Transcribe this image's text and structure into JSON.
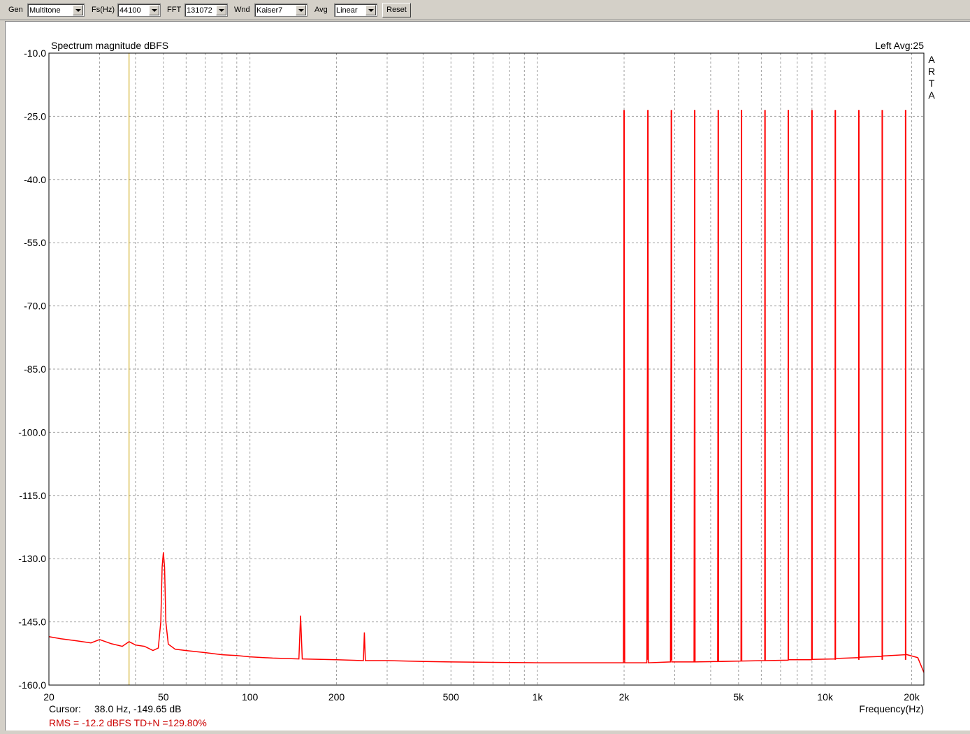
{
  "toolbar": {
    "gen": {
      "label": "Gen",
      "value": "Multitone"
    },
    "fs": {
      "label": "Fs(Hz)",
      "value": "44100"
    },
    "fft": {
      "label": "FFT",
      "value": "131072"
    },
    "wnd": {
      "label": "Wnd",
      "value": "Kaiser7"
    },
    "avg": {
      "label": "Avg",
      "value": "Linear"
    },
    "reset_label": "Reset"
  },
  "status": {
    "cursor_label": "Cursor:",
    "cursor_value": "38.0 Hz, -149.65 dB",
    "rms_text": "RMS =  -12.2 dBFS   TD+N =129.80%"
  },
  "colors": {
    "trace": "#ff0000",
    "cursor": "#c8a000",
    "grid": "#a0a0a0",
    "rms_text": "#cc0000"
  },
  "chart_data": {
    "type": "line",
    "title": "Spectrum magnitude dBFS",
    "channel_label": "Left  Avg:25",
    "brand": "ARTA",
    "xlabel": "Frequency(Hz)",
    "ylabel": "",
    "x_scale": "log",
    "xlim": [
      20,
      22050
    ],
    "ylim": [
      -160,
      -10
    ],
    "grid": true,
    "y_ticks": [
      "-10.0",
      "-25.0",
      "-40.0",
      "-55.0",
      "-70.0",
      "-85.0",
      "-100.0",
      "-115.0",
      "-130.0",
      "-145.0",
      "-160.0"
    ],
    "x_ticks": [
      {
        "value": 20,
        "label": "20"
      },
      {
        "value": 50,
        "label": "50"
      },
      {
        "value": 100,
        "label": "100"
      },
      {
        "value": 200,
        "label": "200"
      },
      {
        "value": 500,
        "label": "500"
      },
      {
        "value": 1000,
        "label": "1k"
      },
      {
        "value": 2000,
        "label": "2k"
      },
      {
        "value": 5000,
        "label": "5k"
      },
      {
        "value": 10000,
        "label": "10k"
      },
      {
        "value": 20000,
        "label": "20k"
      }
    ],
    "cursor_hz": 38.0,
    "series": [
      {
        "points": [
          [
            20,
            -148.5
          ],
          [
            22,
            -149
          ],
          [
            25,
            -149.5
          ],
          [
            28,
            -150
          ],
          [
            30,
            -149.2
          ],
          [
            33,
            -150.2
          ],
          [
            36,
            -150.8
          ],
          [
            38,
            -149.7
          ],
          [
            40,
            -150.5
          ],
          [
            43,
            -150.8
          ],
          [
            46,
            -151.8
          ],
          [
            48,
            -151.2
          ],
          [
            49,
            -145
          ],
          [
            49.5,
            -132
          ],
          [
            50,
            -128.5
          ],
          [
            50.5,
            -132
          ],
          [
            51,
            -145
          ],
          [
            52,
            -150.3
          ],
          [
            55,
            -151.5
          ],
          [
            60,
            -151.8
          ],
          [
            70,
            -152.3
          ],
          [
            80,
            -152.8
          ],
          [
            90,
            -153
          ],
          [
            100,
            -153.3
          ],
          [
            120,
            -153.6
          ],
          [
            148,
            -153.8
          ],
          [
            150,
            -143.5
          ],
          [
            152,
            -153.8
          ],
          [
            200,
            -154
          ],
          [
            248,
            -154.2
          ],
          [
            250,
            -147.5
          ],
          [
            252,
            -154.2
          ],
          [
            300,
            -154.2
          ],
          [
            400,
            -154.4
          ],
          [
            500,
            -154.5
          ],
          [
            700,
            -154.6
          ],
          [
            1000,
            -154.7
          ],
          [
            1500,
            -154.7
          ],
          [
            1990,
            -154.7
          ],
          [
            2000,
            -23.5
          ],
          [
            2010,
            -154.7
          ],
          [
            2400,
            -154.7
          ],
          [
            2420,
            -23.5
          ],
          [
            2430,
            -154.7
          ],
          [
            2900,
            -154.5
          ],
          [
            2920,
            -23.5
          ],
          [
            2930,
            -154.5
          ],
          [
            3500,
            -154.5
          ],
          [
            3520,
            -23.5
          ],
          [
            3530,
            -154.5
          ],
          [
            4230,
            -154.4
          ],
          [
            4250,
            -23.5
          ],
          [
            4260,
            -154.4
          ],
          [
            5100,
            -154.3
          ],
          [
            5120,
            -23.5
          ],
          [
            5130,
            -154.3
          ],
          [
            6170,
            -154.2
          ],
          [
            6180,
            -23.5
          ],
          [
            6190,
            -154.2
          ],
          [
            7440,
            -154.1
          ],
          [
            7450,
            -23.5
          ],
          [
            7460,
            -154
          ],
          [
            8980,
            -154
          ],
          [
            9000,
            -23.5
          ],
          [
            9020,
            -153.9
          ],
          [
            10840,
            -153.8
          ],
          [
            10850,
            -23.5
          ],
          [
            10860,
            -153.7
          ],
          [
            13080,
            -153.5
          ],
          [
            13100,
            -23.5
          ],
          [
            13120,
            -153.4
          ],
          [
            15790,
            -153.2
          ],
          [
            15800,
            -23.5
          ],
          [
            15810,
            -153.1
          ],
          [
            19040,
            -152.8
          ],
          [
            19050,
            -23.5
          ],
          [
            19060,
            -152.7
          ],
          [
            21000,
            -153.5
          ],
          [
            22050,
            -157
          ]
        ]
      }
    ],
    "tones_hz": [
      2000,
      2420,
      2920,
      3520,
      4250,
      5120,
      6180,
      7450,
      9000,
      10850,
      13100,
      15800,
      19050
    ],
    "tone_level_db": -23.5
  }
}
